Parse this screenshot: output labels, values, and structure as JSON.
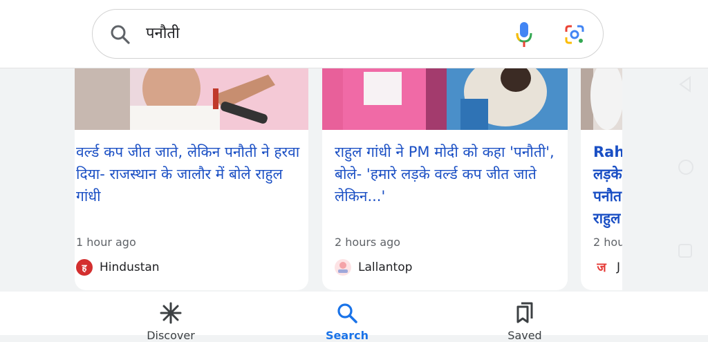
{
  "search": {
    "query": "पनौती"
  },
  "cards": [
    {
      "headline": "वर्ल्ड कप जीत जाते, लेकिन पनौती ने हरवा दिया- राजस्थान के जालौर में बोले राहुल गांधी",
      "time": "1 hour ago",
      "source": "Hindustan",
      "logo_color": "#d32f2f"
    },
    {
      "headline": "राहुल गांधी ने PM मोदी को कहा 'पनौती', बोले- 'हमारे लड़के वर्ल्ड कप जीत जाते लेकिन...'",
      "time": "2 hours ago",
      "source": "Lallantop",
      "logo_color": "#f4a3a8"
    },
    {
      "headline": "Rah लड़के पनौत राहुल",
      "time": "2 hou",
      "source": "J",
      "logo_color": "#e53935"
    }
  ],
  "bottom_nav": {
    "items": [
      {
        "label": "Discover",
        "icon": "asterisk-icon"
      },
      {
        "label": "Search",
        "icon": "search-icon"
      },
      {
        "label": "Saved",
        "icon": "bookmarks-icon"
      }
    ],
    "active_color": "#1a73e8"
  },
  "colors": {
    "headline": "#1a4fc4",
    "background": "#f1f3f4"
  }
}
